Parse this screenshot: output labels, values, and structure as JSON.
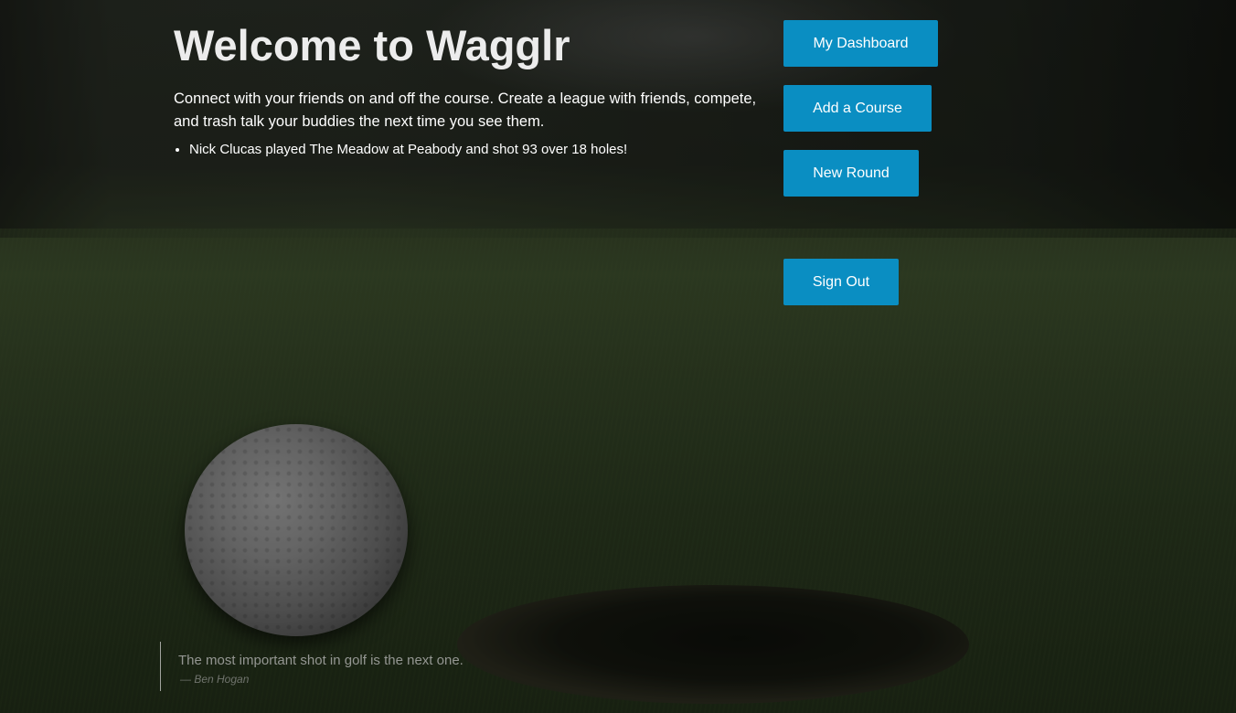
{
  "welcome": {
    "title": "Welcome to Wagglr",
    "intro": "Connect with your friends on and off the course. Create a league with friends, compete, and trash talk your buddies the next time you see them.",
    "feed": [
      "Nick Clucas played The Meadow at Peabody and shot 93 over 18 holes!"
    ]
  },
  "actions": {
    "dashboard_label": "My Dashboard",
    "add_course_label": "Add a Course",
    "new_round_label": "New Round",
    "sign_out_label": "Sign Out"
  },
  "quote": {
    "text": "The most important shot in golf is the next one.",
    "author": "— Ben Hogan"
  },
  "colors": {
    "button": "#0a8ec2",
    "text": "#ffffff"
  }
}
